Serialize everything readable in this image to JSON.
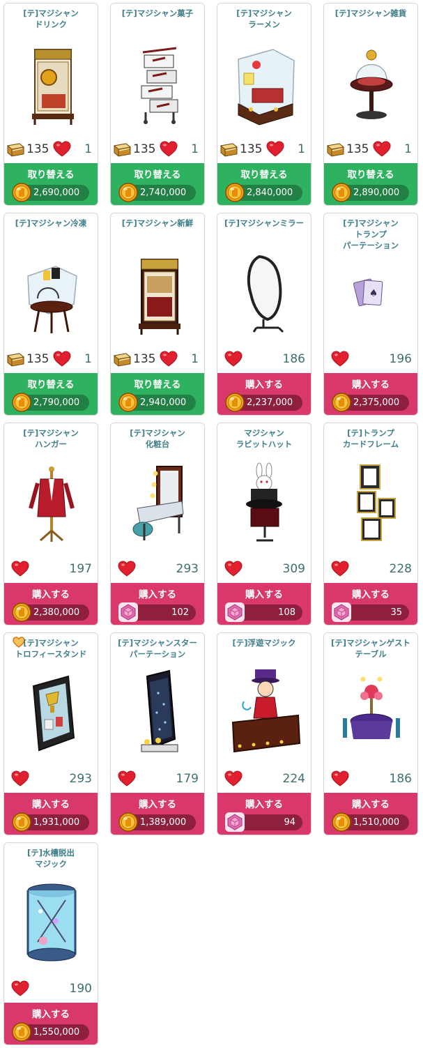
{
  "items": [
    {
      "title": "[テ]マジシャン\nドリンク",
      "tickets": "135",
      "hearts": "1",
      "button": "取り替える",
      "price": "2,690,000",
      "currency": "coin",
      "kind": "trade",
      "art": "cabinet-gold"
    },
    {
      "title": "[テ]マジシャン菓子",
      "tickets": "135",
      "hearts": "1",
      "button": "取り替える",
      "price": "2,740,000",
      "currency": "coin",
      "kind": "trade",
      "art": "drawers"
    },
    {
      "title": "[テ]マジシャン\nラーメン",
      "tickets": "135",
      "hearts": "1",
      "button": "取り替える",
      "price": "2,840,000",
      "currency": "coin",
      "kind": "trade",
      "art": "glass-case"
    },
    {
      "title": "[テ]マジシャン雑貨",
      "tickets": "135",
      "hearts": "1",
      "button": "取り替える",
      "price": "2,890,000",
      "currency": "coin",
      "kind": "trade",
      "art": "dome-table"
    },
    {
      "title": "[テ]マジシャン冷凍",
      "tickets": "135",
      "hearts": "1",
      "button": "取り替える",
      "price": "2,790,000",
      "currency": "coin",
      "kind": "trade",
      "art": "glass-stand"
    },
    {
      "title": "[テ]マジシャン新鮮",
      "tickets": "135",
      "hearts": "1",
      "button": "取り替える",
      "price": "2,940,000",
      "currency": "coin",
      "kind": "trade",
      "art": "cabinet-dark"
    },
    {
      "title": "[テ]マジシャンミラー",
      "hearts": "186",
      "button": "購入する",
      "price": "2,237,000",
      "currency": "coin",
      "kind": "buy",
      "art": "mirror"
    },
    {
      "title": "[テ]マジシャン\nトランプ\nパーテーション",
      "hearts": "196",
      "button": "購入する",
      "price": "2,375,000",
      "currency": "coin",
      "kind": "buy",
      "art": "cards"
    },
    {
      "title": "[テ]マジシャン\nハンガー",
      "hearts": "197",
      "button": "購入する",
      "price": "2,380,000",
      "currency": "coin",
      "kind": "buy",
      "art": "hanger"
    },
    {
      "title": "[テ]マジシャン\n化粧台",
      "hearts": "293",
      "button": "購入する",
      "price": "102",
      "currency": "gem",
      "kind": "buy",
      "art": "vanity"
    },
    {
      "title": "マジシャン\nラビットハット",
      "hearts": "309",
      "button": "購入する",
      "price": "108",
      "currency": "gem",
      "kind": "buy",
      "art": "rabbit-hat"
    },
    {
      "title": "[テ]トランプ\nカードフレーム",
      "hearts": "228",
      "button": "購入する",
      "price": "35",
      "currency": "gem",
      "kind": "buy",
      "art": "card-frame"
    },
    {
      "title": "[テ]マジシャン\nトロフィースタンド",
      "hearts": "293",
      "button": "購入する",
      "price": "1,931,000",
      "currency": "coin",
      "kind": "buy",
      "art": "trophy",
      "favorite": true
    },
    {
      "title": "[テ]マジシャンスター\nパーテーション",
      "hearts": "179",
      "button": "購入する",
      "price": "1,389,000",
      "currency": "coin",
      "kind": "buy",
      "art": "star-partition"
    },
    {
      "title": "[テ]浮遊マジック",
      "hearts": "224",
      "button": "購入する",
      "price": "94",
      "currency": "gem",
      "kind": "buy",
      "art": "magician"
    },
    {
      "title": "[テ]マジシャンゲスト\nテーブル",
      "hearts": "186",
      "button": "購入する",
      "price": "1,510,000",
      "currency": "coin",
      "kind": "buy",
      "art": "guest-table"
    },
    {
      "title": "[テ]水槽脱出\nマジック",
      "hearts": "190",
      "button": "購入する",
      "price": "1,550,000",
      "currency": "coin",
      "kind": "buy",
      "art": "water-tank"
    }
  ],
  "colors": {
    "trade": "#2fb25f",
    "buy": "#d8386a",
    "title": "#3e7f8a",
    "heart": "#e0202e",
    "coin": "#f0a21a",
    "gem": "#e06bb0"
  }
}
